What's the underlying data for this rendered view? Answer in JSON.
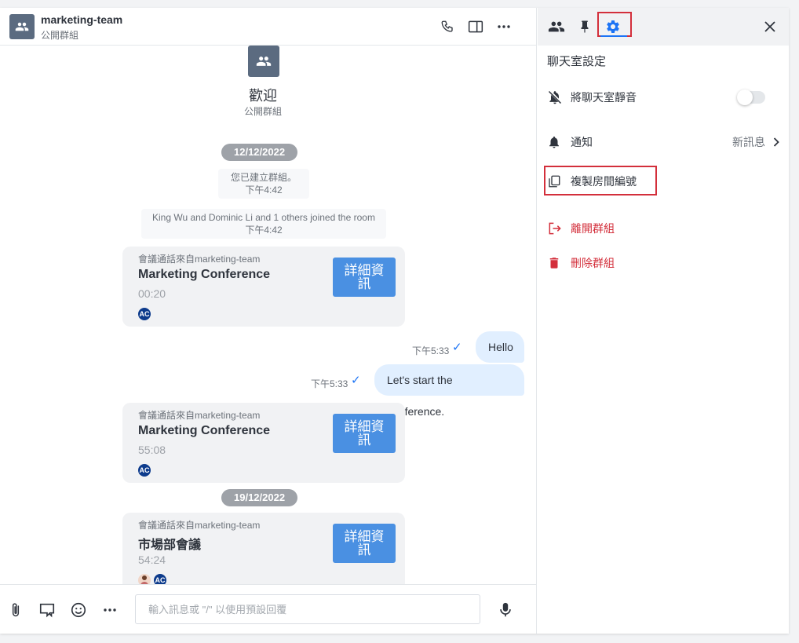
{
  "header": {
    "room_name": "marketing-team",
    "room_type": "公開群組"
  },
  "welcome": {
    "title": "歡迎",
    "subtitle": "公開群組"
  },
  "messages": {
    "date1": "12/12/2022",
    "sys1_text": "您已建立群組。",
    "sys1_time": "下午4:42",
    "sys2_text": "King Wu and Dominic Li and 1 others joined the room",
    "sys2_time": "下午4:42",
    "card1": {
      "from": "會議通話來自marketing-team",
      "title": "Marketing Conference",
      "duration": "00:20",
      "button": "詳細資訊",
      "avatar": "AC"
    },
    "out1": {
      "text": "Hello",
      "time": "下午5:33"
    },
    "out2": {
      "text": "Let's start the conference.",
      "time": "下午5:33"
    },
    "card2": {
      "from": "會議通話來自marketing-team",
      "title": "Marketing Conference",
      "duration": "55:08",
      "button": "詳細資訊",
      "avatar": "AC"
    },
    "date2": "19/12/2022",
    "card3": {
      "from": "會議通話來自marketing-team",
      "title": "市場部會議",
      "duration": "54:24",
      "button": "詳細資訊",
      "avatar": "AC"
    }
  },
  "composer": {
    "placeholder": "輸入訊息或 \"/\" 以使用預設回覆"
  },
  "panel": {
    "title": "聊天室設定",
    "mute_label": "將聊天室靜音",
    "mute_on": false,
    "notify_label": "通知",
    "notify_value": "新訊息",
    "copy_id_label": "複製房間編號",
    "leave_label": "離開群組",
    "delete_label": "刪除群組"
  },
  "colors": {
    "accent": "#1d74f5",
    "button": "#4a90e2",
    "danger": "#d32f3b"
  }
}
